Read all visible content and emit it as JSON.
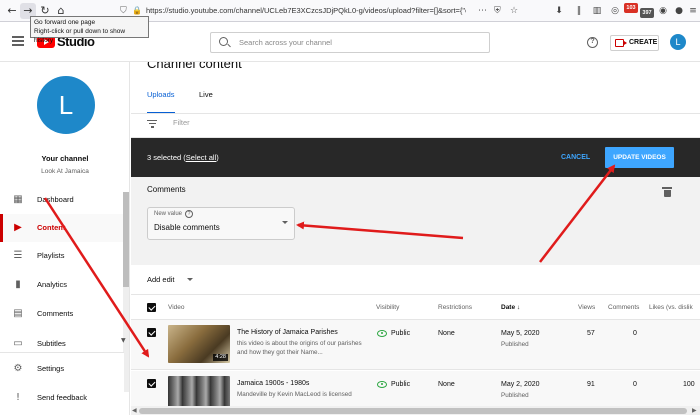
{
  "browser": {
    "url": "https://studio.youtube.com/channel/UCLeb7E3XCzcsJDjPQkL0-g/videos/upload?filter=[]&sort={\"column\"",
    "tooltip_line1": "Go forward one page",
    "tooltip_line2": "Right-click or pull down to show history",
    "badge1": "103",
    "badge2": "397"
  },
  "header": {
    "logo_text": "Studio",
    "search_placeholder": "Search across your channel",
    "help": "?",
    "create_label": "CREATE",
    "avatar_letter": "L"
  },
  "sidebar": {
    "avatar_letter": "L",
    "channel_name": "Your channel",
    "channel_subtitle": "Look At Jamaica",
    "items": [
      {
        "label": "Dashboard",
        "icon": "dashboard-icon"
      },
      {
        "label": "Content",
        "icon": "content-icon"
      },
      {
        "label": "Playlists",
        "icon": "playlists-icon"
      },
      {
        "label": "Analytics",
        "icon": "analytics-icon"
      },
      {
        "label": "Comments",
        "icon": "comments-icon"
      },
      {
        "label": "Subtitles",
        "icon": "subtitles-icon"
      }
    ],
    "footer_items": [
      {
        "label": "Settings",
        "icon": "gear-icon"
      },
      {
        "label": "Send feedback",
        "icon": "feedback-icon"
      }
    ]
  },
  "main": {
    "title": "Channel content",
    "tabs": [
      {
        "label": "Uploads"
      },
      {
        "label": "Live"
      }
    ],
    "filter_placeholder": "Filter",
    "selection": {
      "count_text": "3 selected (",
      "select_all": "Select all",
      "close_paren": ")",
      "cancel": "CANCEL",
      "update": "UPDATE VIDEOS"
    },
    "edit": {
      "title": "Comments",
      "new_value_label": "New value",
      "help": "?",
      "value": "Disable comments"
    },
    "add_edit": "Add edit",
    "columns": {
      "video": "Video",
      "visibility": "Visibility",
      "restrictions": "Restrictions",
      "date": "Date",
      "date_sort": "↓",
      "views": "Views",
      "comments": "Comments",
      "likes": "Likes (vs. dislik"
    },
    "rows": [
      {
        "title": "The History of Jamaica Parishes",
        "description": "this video is about the origins of our parishes and how they got their Name...",
        "duration": "4:28",
        "visibility": "Public",
        "restrictions": "None",
        "date": "May 5, 2020",
        "date_status": "Published",
        "views": "57",
        "comments": "0"
      },
      {
        "title": "Jamaica 1900s - 1980s",
        "description": "Mandeville by Kevin MacLeod is licensed",
        "duration": "",
        "visibility": "Public",
        "restrictions": "None",
        "date": "May 2, 2020",
        "date_status": "Published",
        "views": "91",
        "comments": "0",
        "likes": "100"
      }
    ]
  },
  "colors": {
    "accent": "#065fd4",
    "youtube_red": "#ff0000",
    "update_btn": "#3ea6ff",
    "public_green": "#2ba640",
    "annotation_arrow": "#e01b1b"
  }
}
